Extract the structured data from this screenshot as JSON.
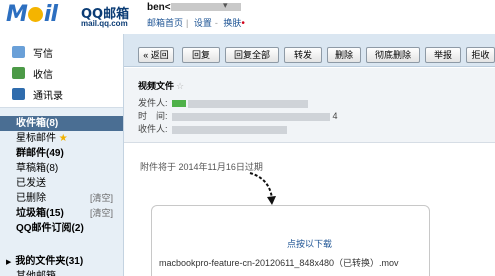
{
  "header": {
    "logo_text": "MOil",
    "brand": "QQ邮箱",
    "brand_url": "mail.qq.com",
    "user_prefix": "ben<",
    "links": [
      "邮箱首页",
      "设置",
      "换肤"
    ]
  },
  "sidebar": {
    "tools": [
      {
        "label": "写信",
        "icon": "write-icon"
      },
      {
        "label": "收信",
        "icon": "inbox-icon"
      },
      {
        "label": "通讯录",
        "icon": "contacts-icon"
      }
    ],
    "folders": [
      {
        "label": "收件箱(8)",
        "active": true
      },
      {
        "label": "星标邮件",
        "star": true
      },
      {
        "label": "群邮件(49)",
        "bold": true
      },
      {
        "label": "草稿箱(8)"
      },
      {
        "label": "已发送"
      },
      {
        "label": "已删除",
        "clear": "[清空]"
      },
      {
        "label": "垃圾箱(15)",
        "bold": true,
        "clear": "[清空]"
      },
      {
        "label": "QQ邮件订阅(2)",
        "bold": true
      }
    ],
    "my_folders": "我的文件夹(31)",
    "other_mail": "其他邮箱"
  },
  "toolbar": {
    "buttons": [
      "« 返回",
      "回复",
      "回复全部",
      "转发",
      "删除",
      "彻底删除",
      "举报",
      "拒收"
    ]
  },
  "mail": {
    "subject": "视频文件",
    "star_glyph": "☆",
    "from_label": "发件人:",
    "time_label": "时　间:",
    "time_tail": "4",
    "to_label": "收件人:",
    "expire_text": "附件将于 2014年11月16日过期",
    "download_text": "点按以下载",
    "file_name": "macbookpro-feature-cn-20120611_848x480（已转换）.mov"
  },
  "colors": {
    "toolbar_bg": "#dae6f1",
    "sidebar_bg": "#e7eff6",
    "active_folder_bg": "#4a6e93",
    "link": "#1e5494"
  }
}
